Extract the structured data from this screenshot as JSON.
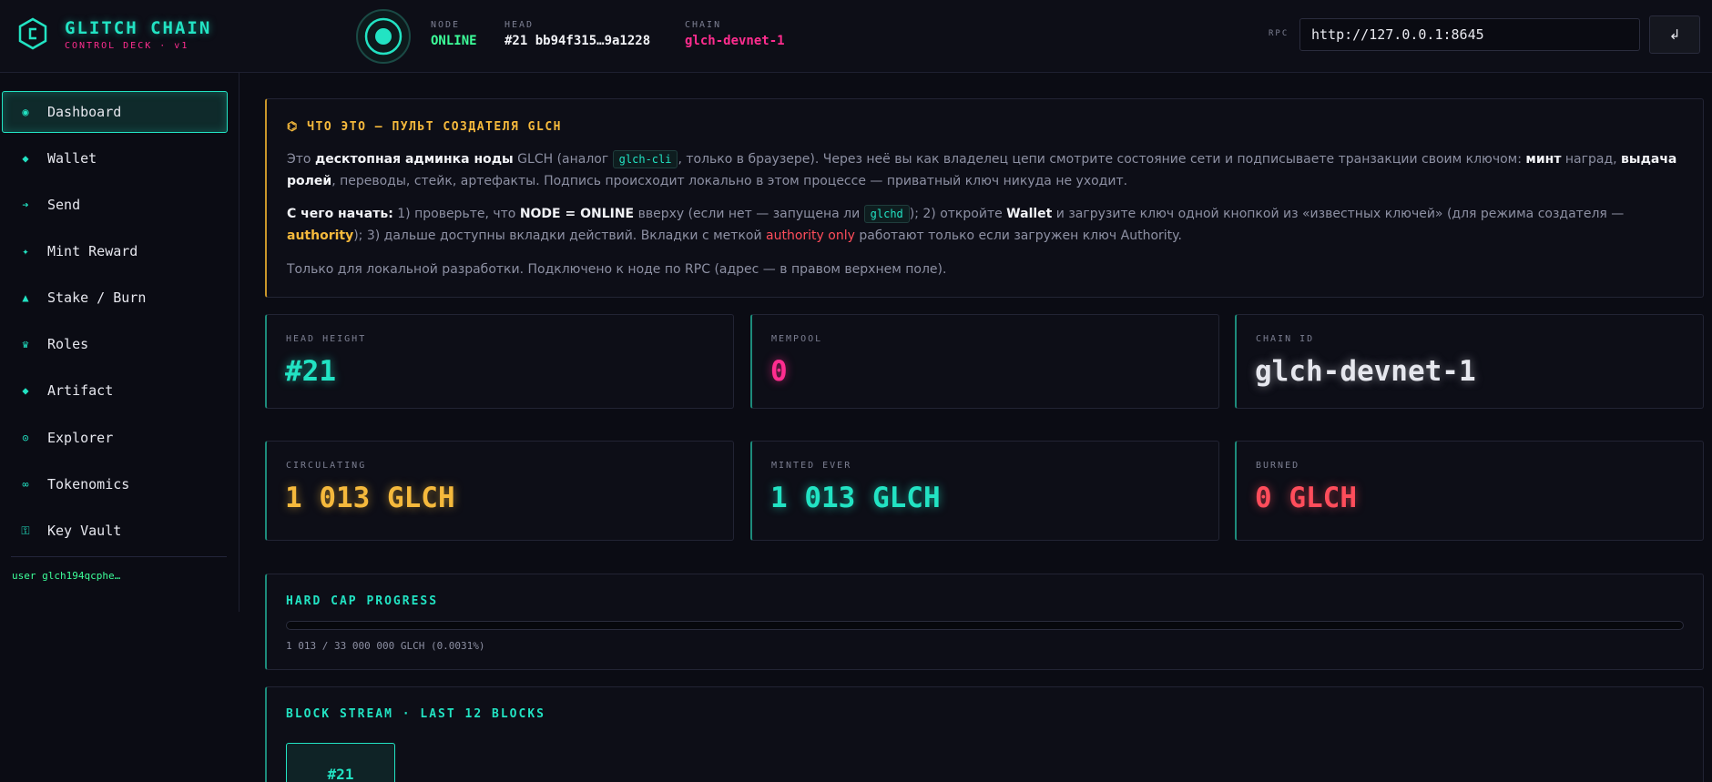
{
  "brand": {
    "title": "GLITCH CHAIN",
    "subtitle": "CONTROL DECK · v1"
  },
  "header": {
    "node_label": "NODE",
    "node_value": "ONLINE",
    "head_label": "HEAD",
    "head_value": "#21 bb94f315…9a1228",
    "chain_label": "CHAIN",
    "chain_value": "glch-devnet-1",
    "rpc_label": "RPC",
    "rpc_value": "http://127.0.0.1:8645",
    "rpc_button": "↲"
  },
  "sidebar": {
    "items": [
      {
        "label": "Dashboard",
        "icon": "dashboard-icon",
        "glyph": "◉"
      },
      {
        "label": "Wallet",
        "icon": "wallet-icon",
        "glyph": "◆"
      },
      {
        "label": "Send",
        "icon": "send-icon",
        "glyph": "➔"
      },
      {
        "label": "Mint Reward",
        "icon": "sparkle-icon",
        "glyph": "✦"
      },
      {
        "label": "Stake / Burn",
        "icon": "triangle-icon",
        "glyph": "▲"
      },
      {
        "label": "Roles",
        "icon": "crown-icon",
        "glyph": "♛"
      },
      {
        "label": "Artifact",
        "icon": "gem-icon",
        "glyph": "◆"
      },
      {
        "label": "Explorer",
        "icon": "compass-icon",
        "glyph": "⊙"
      },
      {
        "label": "Tokenomics",
        "icon": "infinity-icon",
        "glyph": "∞"
      },
      {
        "label": "Key Vault",
        "icon": "key-icon",
        "glyph": "⚿"
      }
    ],
    "user": "user glch194qcphe…"
  },
  "info": {
    "title": "⌬ ЧТО ЭТО — ПУЛЬТ СОЗДАТЕЛЯ GLCH",
    "p1": [
      "Это ",
      "десктопная админка ноды",
      " GLCH (аналог ",
      "glch-cli",
      ", только в браузере). Через неё вы как владелец цепи смотрите состояние сети и подписываете транзакции своим ключом: ",
      "минт",
      " наград, ",
      "выдача ролей",
      ", переводы, стейк, артефакты. Подпись происходит локально в этом процессе — приватный ключ никуда не уходит."
    ],
    "p2": [
      "С чего начать:",
      " 1) проверьте, что ",
      "NODE = ONLINE",
      " вверху (если нет — запущена ли ",
      "glchd",
      "); 2) откройте ",
      "Wallet",
      " и загрузите ключ одной кнопкой из «известных ключей» (для режима создателя — ",
      "authority",
      "); 3) дальше доступны вкладки действий. Вкладки с меткой ",
      "authority only",
      " работают только если загружен ключ Authority."
    ],
    "p3": "Только для локальной разработки. Подключено к ноде по RPC (адрес — в правом верхнем поле)."
  },
  "stats": {
    "head_height": {
      "label": "HEAD HEIGHT",
      "value": "#21"
    },
    "mempool": {
      "label": "MEMPOOL",
      "value": "0"
    },
    "chain_id": {
      "label": "CHAIN ID",
      "value": "glch-devnet-1"
    },
    "circulating": {
      "label": "CIRCULATING",
      "value": "1 013 GLCH"
    },
    "minted_ever": {
      "label": "MINTED EVER",
      "value": "1 013 GLCH"
    },
    "burned": {
      "label": "BURNED",
      "value": "0 GLCH"
    }
  },
  "hard_cap": {
    "title": "HARD CAP PROGRESS",
    "text": "1 013 / 33 000 000 GLCH (0.0031%)",
    "progress_percent": 0.0031
  },
  "block_stream": {
    "title": "BLOCK STREAM · LAST 12 BLOCKS",
    "blocks": [
      "#21"
    ]
  },
  "colors": {
    "accent": "#22e3c3",
    "pink": "#ff2d8f",
    "gold": "#f5b93c",
    "red": "#ff4d5b",
    "green": "#3dff9a"
  }
}
